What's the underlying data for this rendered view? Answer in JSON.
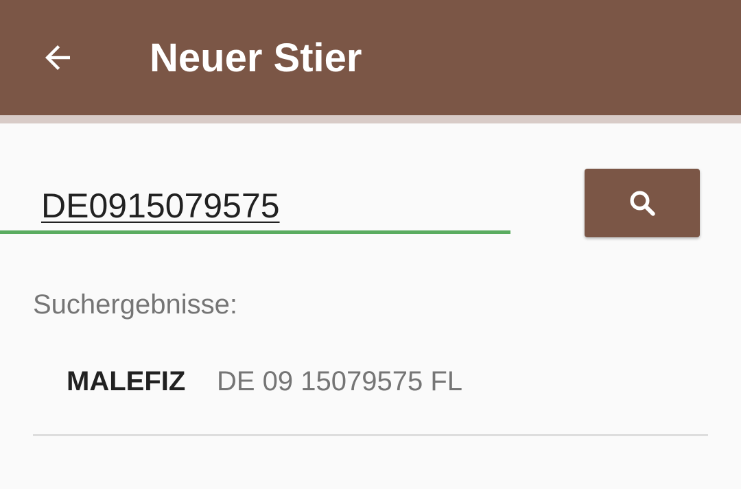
{
  "appbar": {
    "title": "Neuer Stier",
    "back_icon": "arrow-left-icon",
    "color": "#7b5646"
  },
  "search": {
    "value": "DE0915079575",
    "placeholder": "",
    "button_icon": "search-icon",
    "underline_color": "#5aac60"
  },
  "results": {
    "label": "Suchergebnisse:",
    "items": [
      {
        "name": "MALEFIZ",
        "id": "DE 09 15079575 FL"
      }
    ]
  }
}
